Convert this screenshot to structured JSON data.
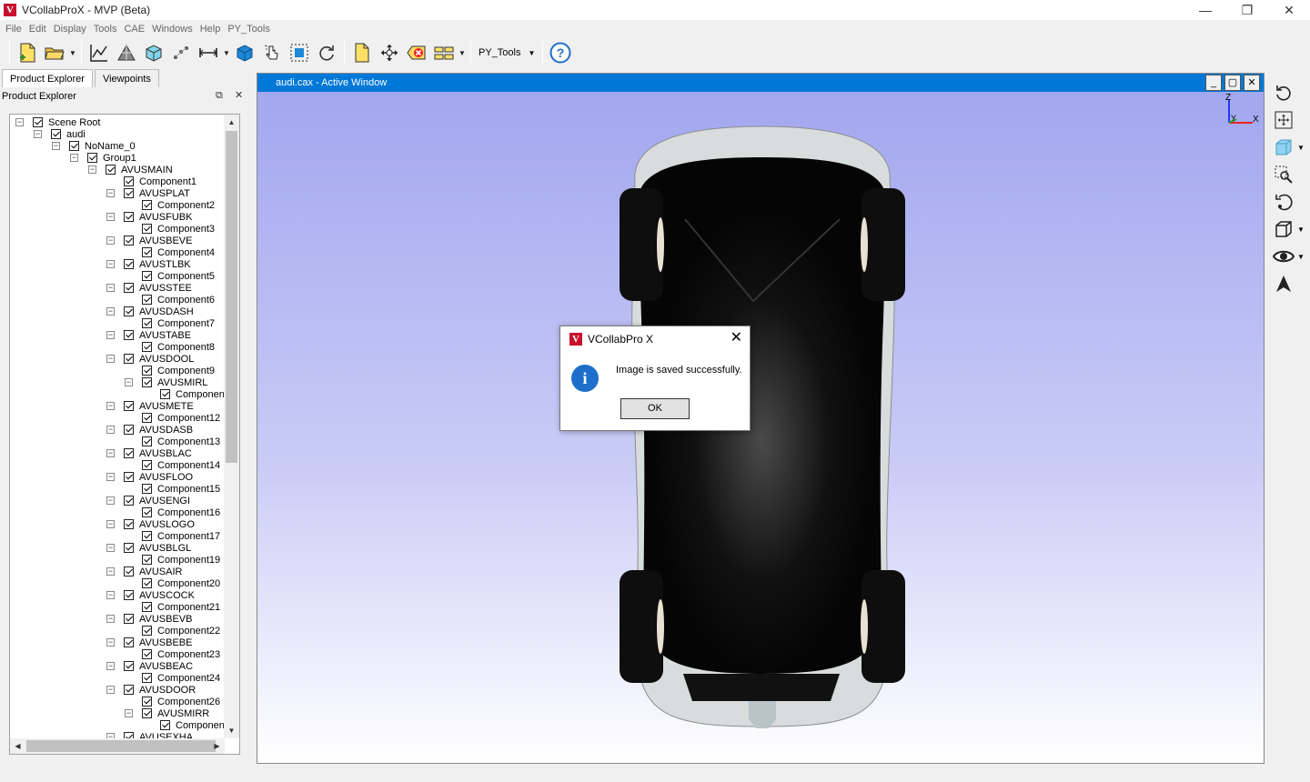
{
  "window": {
    "title": "VCollabProX - MVP (Beta)",
    "minimize": "—",
    "restore": "❐",
    "close": "✕"
  },
  "menu": [
    "File",
    "Edit",
    "Display",
    "Tools",
    "CAE",
    "Windows",
    "Help",
    "PY_Tools"
  ],
  "toolbar": {
    "py_tools_label": "PY_Tools"
  },
  "left_panel": {
    "tabs": [
      "Product Explorer",
      "Viewpoints"
    ],
    "header_title": "Product Explorer",
    "tree": [
      {
        "label": "Scene Root",
        "level": 0,
        "exp": "-"
      },
      {
        "label": "audi",
        "level": 1,
        "exp": "-"
      },
      {
        "label": "NoName_0",
        "level": 2,
        "exp": "-"
      },
      {
        "label": "Group1",
        "level": 3,
        "exp": "-"
      },
      {
        "label": "AVUSMAIN",
        "level": 4,
        "exp": "-"
      },
      {
        "label": "Component1",
        "level": 5,
        "exp": ""
      },
      {
        "label": "AVUSPLAT",
        "level": 5,
        "exp": "-"
      },
      {
        "label": "Component2",
        "level": 6,
        "exp": ""
      },
      {
        "label": "AVUSFUBK",
        "level": 5,
        "exp": "-"
      },
      {
        "label": "Component3",
        "level": 6,
        "exp": ""
      },
      {
        "label": "AVUSBEVE",
        "level": 5,
        "exp": "-"
      },
      {
        "label": "Component4",
        "level": 6,
        "exp": ""
      },
      {
        "label": "AVUSTLBK",
        "level": 5,
        "exp": "-"
      },
      {
        "label": "Component5",
        "level": 6,
        "exp": ""
      },
      {
        "label": "AVUSSTEE",
        "level": 5,
        "exp": "-"
      },
      {
        "label": "Component6",
        "level": 6,
        "exp": ""
      },
      {
        "label": "AVUSDASH",
        "level": 5,
        "exp": "-"
      },
      {
        "label": "Component7",
        "level": 6,
        "exp": ""
      },
      {
        "label": "AVUSTABE",
        "level": 5,
        "exp": "-"
      },
      {
        "label": "Component8",
        "level": 6,
        "exp": ""
      },
      {
        "label": "AVUSDOOL",
        "level": 5,
        "exp": "-"
      },
      {
        "label": "Component9",
        "level": 6,
        "exp": ""
      },
      {
        "label": "AVUSMIRL",
        "level": 6,
        "exp": "-"
      },
      {
        "label": "Component",
        "level": 7,
        "exp": ""
      },
      {
        "label": "AVUSMETE",
        "level": 5,
        "exp": "-"
      },
      {
        "label": "Component12",
        "level": 6,
        "exp": ""
      },
      {
        "label": "AVUSDASB",
        "level": 5,
        "exp": "-"
      },
      {
        "label": "Component13",
        "level": 6,
        "exp": ""
      },
      {
        "label": "AVUSBLAC",
        "level": 5,
        "exp": "-"
      },
      {
        "label": "Component14",
        "level": 6,
        "exp": ""
      },
      {
        "label": "AVUSFLOO",
        "level": 5,
        "exp": "-"
      },
      {
        "label": "Component15",
        "level": 6,
        "exp": ""
      },
      {
        "label": "AVUSENGI",
        "level": 5,
        "exp": "-"
      },
      {
        "label": "Component16",
        "level": 6,
        "exp": ""
      },
      {
        "label": "AVUSLOGO",
        "level": 5,
        "exp": "-"
      },
      {
        "label": "Component17",
        "level": 6,
        "exp": ""
      },
      {
        "label": "AVUSBLGL",
        "level": 5,
        "exp": "-"
      },
      {
        "label": "Component19",
        "level": 6,
        "exp": ""
      },
      {
        "label": "AVUSAIR",
        "level": 5,
        "exp": "-"
      },
      {
        "label": "Component20",
        "level": 6,
        "exp": ""
      },
      {
        "label": "AVUSCOCK",
        "level": 5,
        "exp": "-"
      },
      {
        "label": "Component21",
        "level": 6,
        "exp": ""
      },
      {
        "label": "AVUSBEVB",
        "level": 5,
        "exp": "-"
      },
      {
        "label": "Component22",
        "level": 6,
        "exp": ""
      },
      {
        "label": "AVUSBEBE",
        "level": 5,
        "exp": "-"
      },
      {
        "label": "Component23",
        "level": 6,
        "exp": ""
      },
      {
        "label": "AVUSBEAC",
        "level": 5,
        "exp": "-"
      },
      {
        "label": "Component24",
        "level": 6,
        "exp": ""
      },
      {
        "label": "AVUSDOOR",
        "level": 5,
        "exp": "-"
      },
      {
        "label": "Component26",
        "level": 6,
        "exp": ""
      },
      {
        "label": "AVUSMIRR",
        "level": 6,
        "exp": "-"
      },
      {
        "label": "Component",
        "level": 7,
        "exp": ""
      },
      {
        "label": "AVUSEXHA",
        "level": 5,
        "exp": "-"
      }
    ]
  },
  "viewport": {
    "title": "audi.cax -  Active Window",
    "axes": {
      "z": "Z",
      "y": "Y",
      "x": "X"
    },
    "nav_back": "🠐",
    "nav_forward": "🠒"
  },
  "dialog": {
    "title": "VCollabPro X",
    "message": "Image is saved successfully.",
    "ok_label": "OK",
    "close": "✕",
    "info_glyph": "i"
  },
  "colors": {
    "accent": "#0078d7",
    "viewport_top": "#a2a7ef",
    "viewport_bottom": "#ffffff",
    "car_body": "#0a0a0a",
    "car_trim": "#d9dcdc",
    "brand": "#c8102e"
  }
}
